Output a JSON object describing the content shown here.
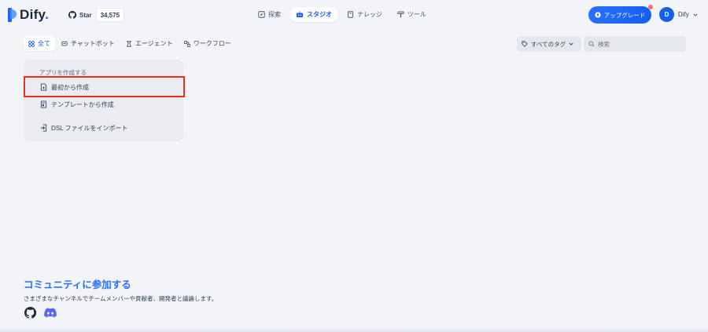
{
  "header": {
    "logo_text": "Dify",
    "logo_suffix": ".",
    "github_star_label": "Star",
    "github_star_count": "34,575",
    "nav": [
      {
        "label": "探索",
        "icon": "compass-icon"
      },
      {
        "label": "スタジオ",
        "icon": "robot-icon",
        "active": true
      },
      {
        "label": "ナレッジ",
        "icon": "book-icon"
      },
      {
        "label": "ツール",
        "icon": "hammer-icon"
      }
    ],
    "upgrade_label": "アップグレード",
    "user_initial": "D",
    "user_name": "Dify"
  },
  "toolbar": {
    "filters": [
      {
        "label": "全て",
        "icon": "grid-icon",
        "active": true
      },
      {
        "label": "チャットボット",
        "icon": "chat-icon"
      },
      {
        "label": "エージェント",
        "icon": "agent-icon"
      },
      {
        "label": "ワークフロー",
        "icon": "workflow-icon"
      }
    ],
    "tags_label": "すべてのタグ",
    "search_placeholder": "検索"
  },
  "create_card": {
    "title": "アプリを作成する",
    "options": [
      {
        "label": "最初から作成",
        "icon": "file-plus-icon"
      },
      {
        "label": "テンプレートから作成",
        "icon": "template-icon"
      },
      {
        "label": "DSL ファイルをインポート",
        "icon": "import-icon"
      }
    ]
  },
  "community": {
    "title": "コミュニティに参加する",
    "description": "さまざまなチャンネルでチームメンバーや貢献者、開発者と議論します。"
  },
  "colors": {
    "accent": "#155eef",
    "highlight": "#e5321f",
    "background": "#f2f4f7"
  }
}
